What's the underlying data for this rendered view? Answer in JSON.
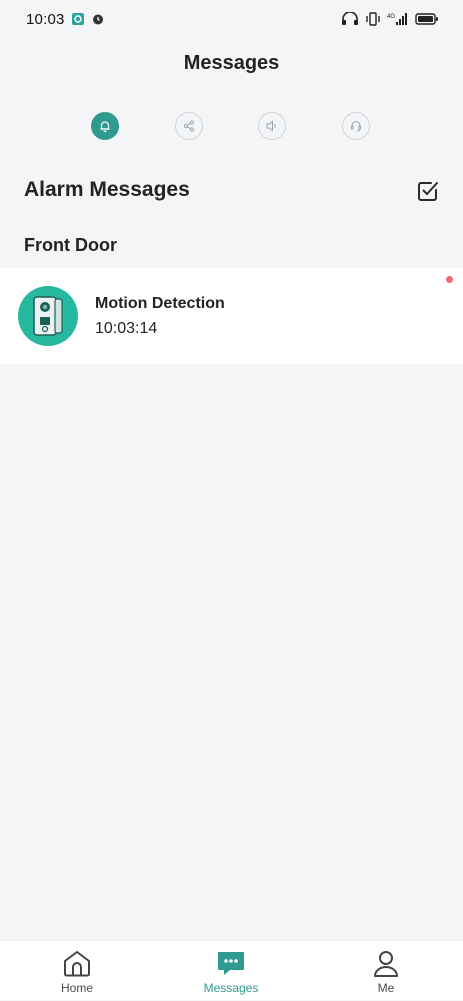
{
  "status_bar": {
    "time": "10:03",
    "network_label": "4G"
  },
  "header": {
    "title": "Messages"
  },
  "filters": [
    {
      "icon": "bell-icon",
      "active": true
    },
    {
      "icon": "share-icon",
      "active": false
    },
    {
      "icon": "speaker-icon",
      "active": false
    },
    {
      "icon": "headset-icon",
      "active": false
    }
  ],
  "section": {
    "title": "Alarm Messages"
  },
  "group": {
    "title": "Front Door"
  },
  "messages": [
    {
      "title": "Motion Detection",
      "time": "10:03:14",
      "unread": true
    }
  ],
  "bottom_nav": {
    "items": [
      {
        "label": "Home",
        "icon": "home-icon",
        "active": false
      },
      {
        "label": "Messages",
        "icon": "chat-icon",
        "active": true
      },
      {
        "label": "Me",
        "icon": "person-icon",
        "active": false
      }
    ]
  },
  "colors": {
    "accent": "#2f9a90",
    "avatar": "#27b99f",
    "unread_dot": "#ef6b6b",
    "background": "#f3f5f7"
  }
}
